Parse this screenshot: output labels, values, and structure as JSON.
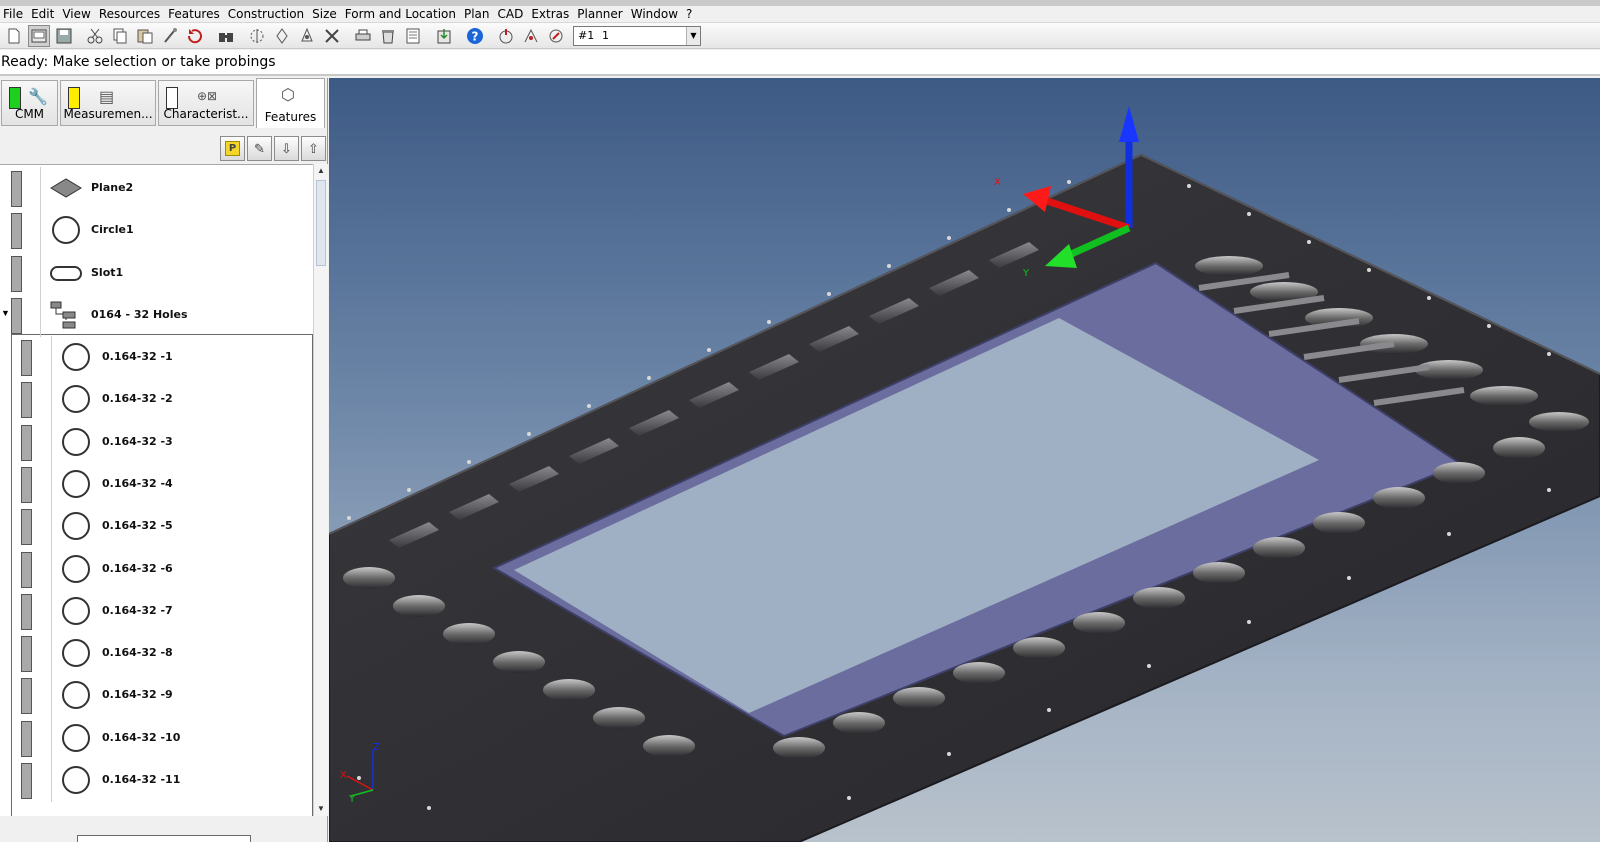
{
  "menu": [
    "File",
    "Edit",
    "View",
    "Resources",
    "Features",
    "Construction",
    "Size",
    "Form and Location",
    "Plan",
    "CAD",
    "Extras",
    "Planner",
    "Window",
    "?"
  ],
  "toolbar": {
    "icons": [
      "new-icon",
      "open-icon",
      "save-icon",
      "cut-icon",
      "copy-icon",
      "paste-icon",
      "probe-icon",
      "undo-icon",
      "find-icon",
      "measure-icon",
      "align-icon",
      "csy-icon",
      "tools-icon",
      "print-icon",
      "delete-icon",
      "report-icon",
      "export-icon",
      "help-icon",
      "run-icon",
      "run-selected-icon",
      "stop-icon"
    ],
    "plan_id": "#1",
    "plan_value": "1"
  },
  "status": "Ready: Make selection or take probings",
  "tabs": [
    {
      "label": "CMM",
      "color": "#1fcf1f",
      "icon": "wrench-icon"
    },
    {
      "label": "Measuremen...",
      "color": "#ffee00",
      "icon": "document-icon"
    },
    {
      "label": "Characterist...",
      "color": "#ffffff",
      "icon": "tolerance-icon"
    },
    {
      "label": "Features",
      "color": "",
      "icon": "features-icon"
    }
  ],
  "tree_tools": [
    "P",
    "edit",
    "move-down",
    "move-up"
  ],
  "features": [
    {
      "name": "Plane2",
      "type": "plane"
    },
    {
      "name": "Circle1",
      "type": "circle"
    },
    {
      "name": "Slot1",
      "type": "slot"
    },
    {
      "name": "0164 - 32 Holes",
      "type": "group"
    }
  ],
  "holes": [
    "0.164-32 -1",
    "0.164-32 -2",
    "0.164-32 -3",
    "0.164-32 -4",
    "0.164-32 -5",
    "0.164-32 -6",
    "0.164-32 -7",
    "0.164-32 -8",
    "0.164-32 -9",
    "0.164-32 -10",
    "0.164-32 -11"
  ],
  "viewport": {
    "axis_labels": {
      "x": "X",
      "y": "Y",
      "z": "Z"
    },
    "colors": {
      "x_axis": "#e01010",
      "y_axis": "#10c020",
      "z_axis": "#1030e0",
      "frame": "#2f2f33",
      "ledge": "#6b6d9e"
    }
  }
}
